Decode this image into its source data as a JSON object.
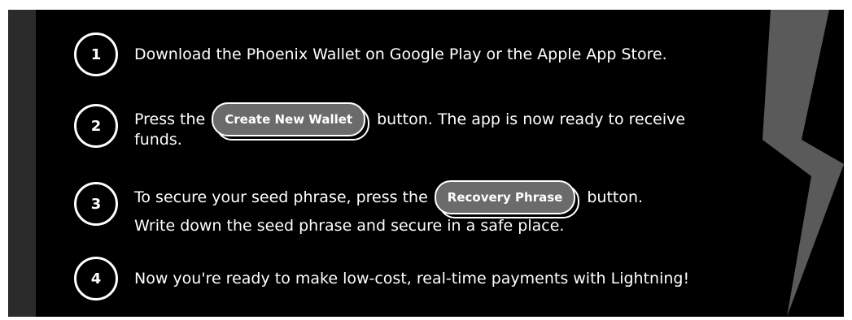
{
  "steps": [
    {
      "number": "1",
      "before": "Download the Phoenix Wallet on Google Play or the Apple App Store.",
      "button": "",
      "after": "",
      "line2": ""
    },
    {
      "number": "2",
      "before": "Press the",
      "button": "Create New Wallet",
      "after": "button. The app is now ready to receive",
      "line2": "funds."
    },
    {
      "number": "3",
      "before": "To secure your seed phrase, press the",
      "button": "Recovery Phrase",
      "after": "button.",
      "line2": "Write down the seed phrase and secure in a safe place."
    },
    {
      "number": "4",
      "before": "Now you're ready to make low-cost, real-time payments with Lightning!",
      "button": "",
      "after": "",
      "line2": ""
    }
  ],
  "colors": {
    "background": "#000000",
    "text": "#ffffff",
    "pill": "#6b6b6b",
    "sidebar": "#2b2b2b",
    "bolt": "#5a5a5a"
  },
  "icons": [
    "lightning-bolt-icon"
  ]
}
